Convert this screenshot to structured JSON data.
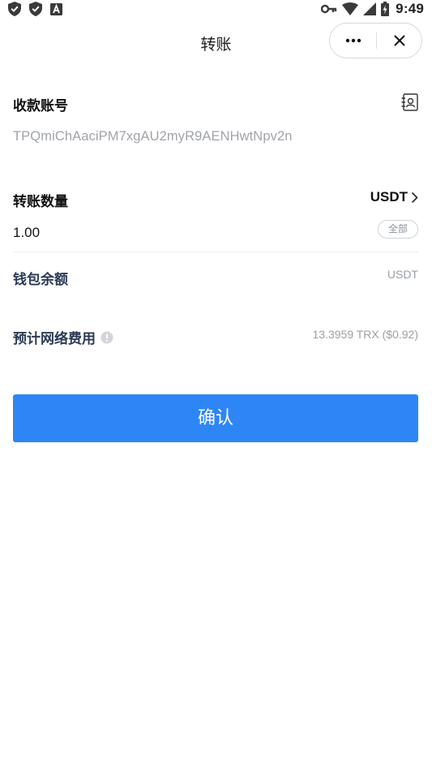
{
  "status_bar": {
    "time": "9:49"
  },
  "header": {
    "title": "转账"
  },
  "form": {
    "recipient_label": "收款账号",
    "recipient_address": "TPQmiChAaciPM7xgAU2myR9AENHwtNpv2n",
    "amount_label": "转账数量",
    "token": "USDT",
    "amount_value": "1.00",
    "all_label": "全部",
    "balance_label": "钱包余额",
    "balance_value": "USDT",
    "fee_label": "预计网络费用",
    "fee_value": "13.3959 TRX ($0.92)"
  },
  "confirm_label": "确认",
  "colors": {
    "primary": "#2e86f6",
    "label_dark": "#2b3a55",
    "muted": "#a0a4aa",
    "background": "#ffffff"
  },
  "icons": {
    "status_left": [
      "shield-check-icon",
      "shield-check-icon",
      "app-a-icon"
    ],
    "status_right": [
      "vpn-key-icon",
      "wifi-icon",
      "cell-signal-icon",
      "battery-charging-icon"
    ],
    "header": [
      "more-dots-icon",
      "close-icon"
    ],
    "form": [
      "contacts-book-icon",
      "chevron-right-icon",
      "info-icon"
    ]
  }
}
